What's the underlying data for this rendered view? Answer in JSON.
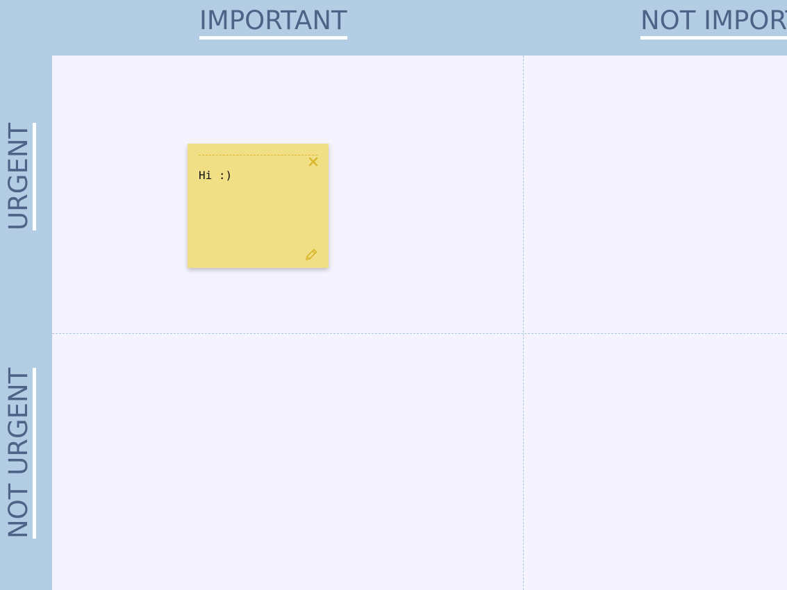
{
  "columns": {
    "important": "IMPORTANT",
    "not_important": "NOT IMPORTANT"
  },
  "rows": {
    "urgent": "URGENT",
    "not_urgent": "NOT URGENT"
  },
  "notes": [
    {
      "text": "Hi :)",
      "quadrant": "urgent-important",
      "color": "#f0df84",
      "close_icon": "close-icon",
      "edit_icon": "pencil-icon"
    }
  ],
  "colors": {
    "header_background": "#b3cde4",
    "header_text": "#4d6387",
    "board_background": "#f4f3fe",
    "divider": "#a9c6dc",
    "note_accent": "#d9b62a"
  }
}
